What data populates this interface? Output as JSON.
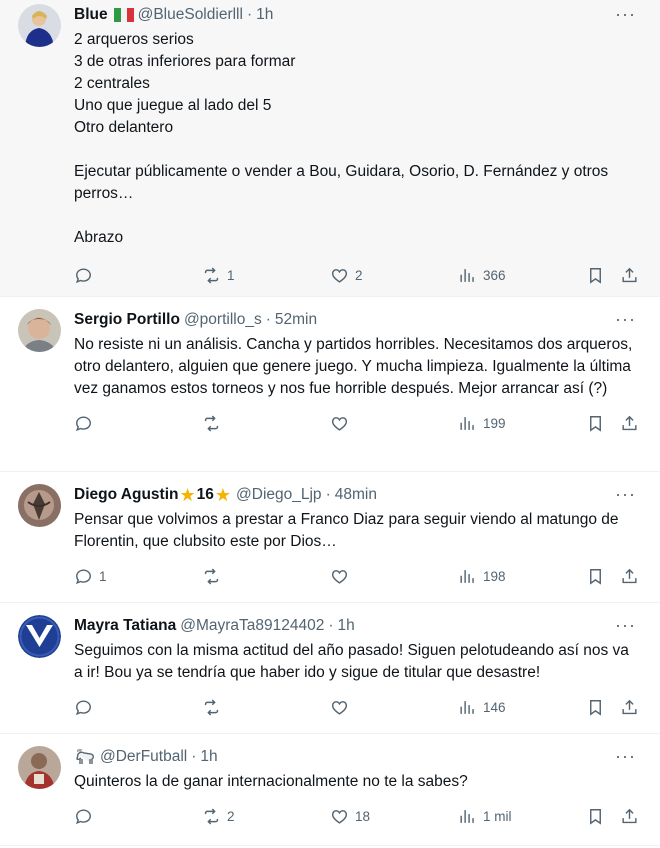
{
  "colors": {
    "text": "#0f1419",
    "secondary": "#536471",
    "highlight_bg": "#f7f7f7",
    "divider": "#eff3f4",
    "star": "#f4b400"
  },
  "tweets": [
    {
      "name": "Blue",
      "flag": "italy-flag",
      "handle": "@BlueSoldierlll",
      "time": "1h",
      "text": "2 arqueros serios\n3 de otras inferiores para formar\n2 centrales\nUno que juegue al lado del 5\nOtro delantero\n\nEjecutar públicamente o vender a Bou, Guidara, Osorio, D. Fernández y otros perros…\n\nAbrazo",
      "replies": "",
      "retweets": "1",
      "likes": "2",
      "views": "366"
    },
    {
      "name": "Sergio Portillo",
      "handle": "@portillo_s",
      "time": "52min",
      "text": "No resiste ni un análisis. Cancha y partidos horribles. Necesitamos dos arqueros, otro delantero, alguien que genere juego. Y mucha limpieza. Igualmente la última vez ganamos estos torneos y nos fue horrible después. Mejor arrancar así (?)",
      "replies": "",
      "retweets": "",
      "likes": "",
      "views": "199"
    },
    {
      "name": "Diego Agustin",
      "name_suffix": "16",
      "handle": "@Diego_Ljp",
      "time": "48min",
      "text": "Pensar que volvimos a prestar a Franco Diaz para seguir viendo al matungo de Florentin, que clubsito este por Dios…",
      "replies": "1",
      "retweets": "",
      "likes": "",
      "views": "198"
    },
    {
      "name": "Mayra Tatiana",
      "handle": "@MayraTa89124402",
      "time": "1h",
      "text": "Seguimos con la misma actitud del año pasado! Siguen pelotudeando así nos va a ir! Bou ya se tendría que haber ido y sigue de titular que desastre!",
      "replies": "",
      "retweets": "",
      "likes": "",
      "views": "146"
    },
    {
      "name_icon": "goat-emoji",
      "handle": "@DerFutball",
      "time": "1h",
      "text": "Quinteros la de ganar internacionalmente no te la sabes?",
      "replies": "",
      "retweets": "2",
      "likes": "18",
      "views": "1 mil"
    }
  ],
  "common": {
    "dot": "·",
    "more": "···",
    "star": "★"
  }
}
